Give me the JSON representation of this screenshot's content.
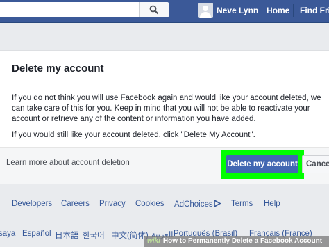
{
  "topbar": {
    "user_name": "Neve Lynn",
    "home_label": "Home",
    "find_friends_label": "Find Frie"
  },
  "dialog": {
    "title": "Delete my account",
    "paragraph1": "If you do not think you will use Facebook again and would like your account deleted, we can take care of this for you. Keep in mind that you will not be able to reactivate your account or retrieve any of the content or information you have added.",
    "paragraph2": "If you would still like your account deleted, click \"Delete My Account\".",
    "learn_more": "Learn more about account deletion",
    "delete_button": "Delete my account",
    "cancel_button": "Cancel",
    "highlight_color": "#00ff00",
    "button_color": "#4267b2"
  },
  "footer_links": [
    "Developers",
    "Careers",
    "Privacy",
    "Cookies",
    "AdChoices",
    "Terms",
    "Help"
  ],
  "languages": [
    "saya",
    "Español",
    "日本語",
    "한국어",
    "中文(简体)",
    "العربية",
    "Português (Brasil)",
    "Français (France)"
  ],
  "watermark": {
    "brand": "wiki",
    "text": "How to Permanently Delete a Facebook Account"
  },
  "colors": {
    "topbar": "#3b5998",
    "link": "#365899"
  }
}
